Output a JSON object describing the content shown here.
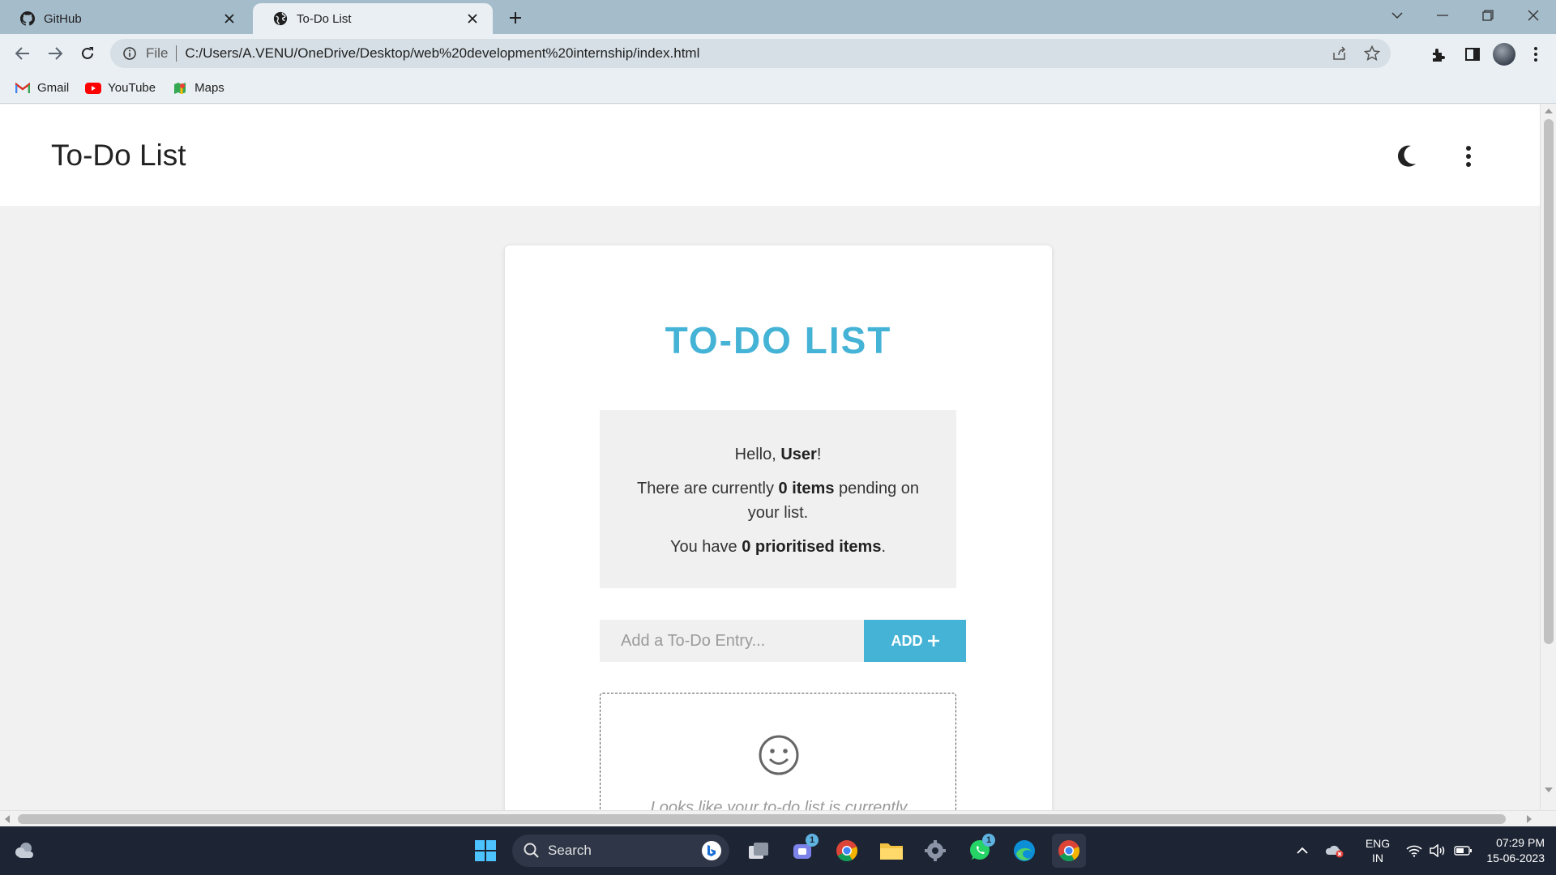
{
  "browser": {
    "tabs": [
      {
        "title": "GitHub",
        "icon": "github-icon",
        "active": false
      },
      {
        "title": "To-Do List",
        "icon": "globe-icon",
        "active": true
      }
    ],
    "address": {
      "scheme": "File",
      "url": "C:/Users/A.VENU/OneDrive/Desktop/web%20development%20internship/index.html"
    },
    "bookmarks": [
      {
        "label": "Gmail",
        "icon": "gmail-icon"
      },
      {
        "label": "YouTube",
        "icon": "youtube-icon"
      },
      {
        "label": "Maps",
        "icon": "maps-icon"
      }
    ]
  },
  "app": {
    "header_title": "To-Do List",
    "card_title": "TO-DO LIST",
    "summary": {
      "greeting_prefix": "Hello, ",
      "user_name": "User",
      "greeting_suffix": "!",
      "pending_prefix": "There are currently ",
      "pending_count": "0 items",
      "pending_suffix": " pending on your list.",
      "priority_prefix": "You have ",
      "priority_count": "0 prioritised items",
      "priority_suffix": "."
    },
    "entry": {
      "placeholder": "Add a To-Do Entry...",
      "add_label": "ADD"
    },
    "empty_state": {
      "icon": "smiley-icon",
      "message": "Looks like your to-do list is currently"
    }
  },
  "taskbar": {
    "search_label": "Search",
    "teams_badge": "1",
    "whatsapp_badge": "1",
    "language": {
      "line1": "ENG",
      "line2": "IN"
    },
    "time": "07:29 PM",
    "date": "15-06-2023"
  },
  "colors": {
    "accent": "#45b3d6",
    "tabstrip": "#a5bccb",
    "toolbar": "#e9eff3",
    "taskbar": "#1d2433"
  }
}
